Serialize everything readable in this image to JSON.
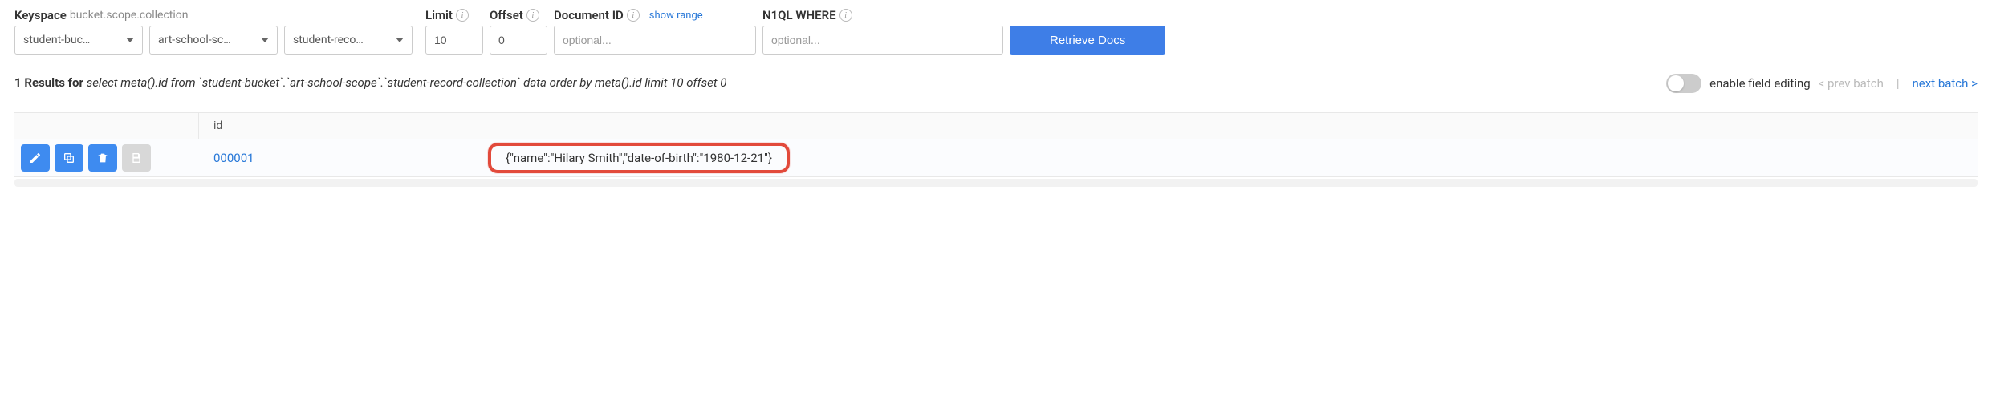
{
  "keyspace": {
    "label": "Keyspace",
    "sublabel": "bucket.scope.collection",
    "bucket": "student-buc…",
    "scope": "art-school-sc…",
    "collection": "student-reco…"
  },
  "limit": {
    "label": "Limit",
    "value": "10"
  },
  "offset": {
    "label": "Offset",
    "value": "0"
  },
  "docid": {
    "label": "Document ID",
    "placeholder": "optional...",
    "show_range": "show range"
  },
  "n1ql": {
    "label": "N1QL WHERE",
    "placeholder": "optional..."
  },
  "retrieve_label": "Retrieve Docs",
  "results_summary": {
    "count_prefix": "1 Results for ",
    "query": "select meta().id from `student-bucket`.`art-school-scope`.`student-record-collection` data order by meta().id limit 10 offset 0"
  },
  "controls": {
    "toggle_label": "enable field editing",
    "prev": "< prev batch",
    "next": "next batch >"
  },
  "table": {
    "id_header": "id",
    "rows": [
      {
        "id": "000001",
        "content": "{\"name\":\"Hilary Smith\",\"date-of-birth\":\"1980-12-21\"}"
      }
    ]
  }
}
